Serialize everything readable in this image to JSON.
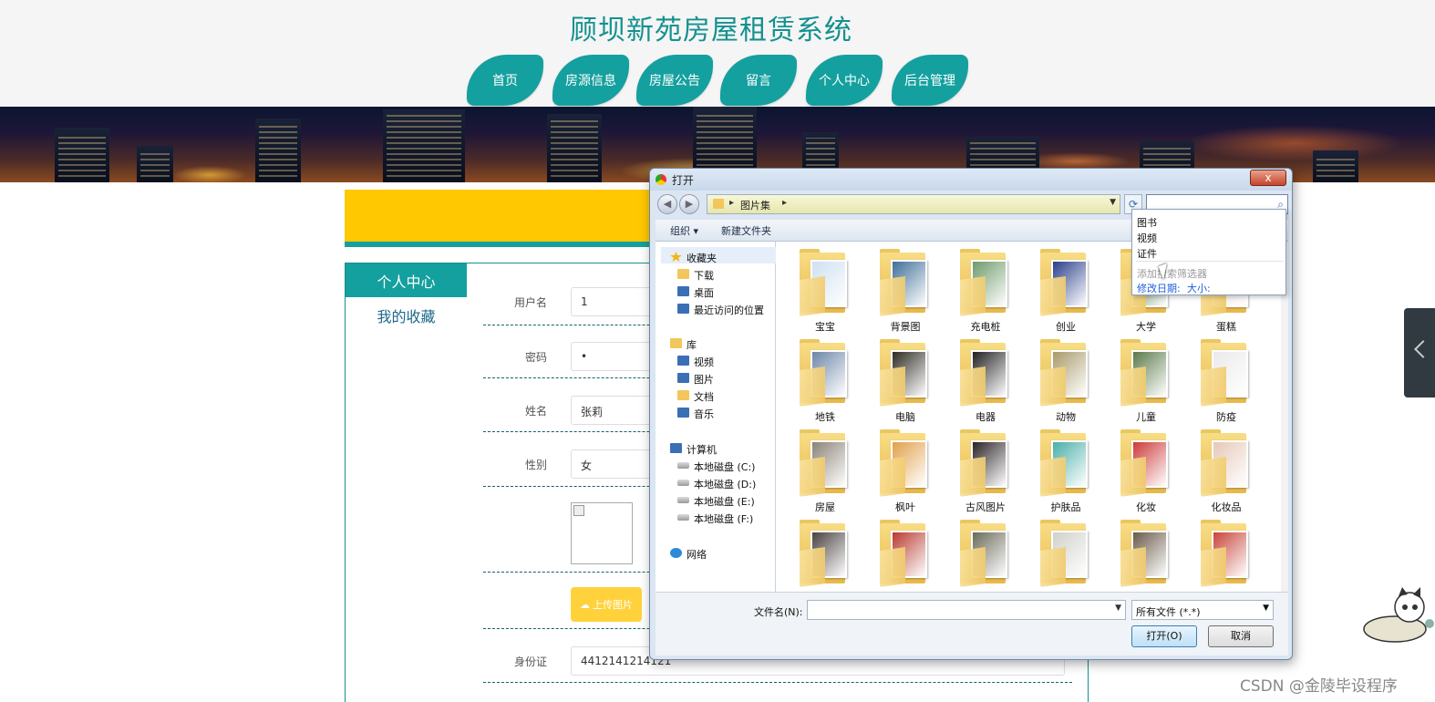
{
  "site": {
    "title": "顾坝新苑房屋租赁系统"
  },
  "nav": [
    "首页",
    "房源信息",
    "房屋公告",
    "留言",
    "个人中心",
    "后台管理"
  ],
  "sidebar": {
    "header": "个人中心",
    "link": "我的收藏"
  },
  "form": {
    "fields": [
      {
        "label": "用户名",
        "value": "1"
      },
      {
        "label": "密码",
        "value": "•"
      },
      {
        "label": "姓名",
        "value": "张莉"
      },
      {
        "label": "性别",
        "value": "女"
      },
      {
        "label": "身份证",
        "value": "4412141214121"
      }
    ],
    "upload_label": "上传图片"
  },
  "dialog": {
    "title": "打开",
    "close": "x",
    "breadcrumb": "图片集",
    "toolbar": {
      "organize": "组织 ▾",
      "new_folder": "新建文件夹"
    },
    "nav": {
      "favorites": "收藏夹",
      "downloads": "下载",
      "desktop": "桌面",
      "recent": "最近访问的位置",
      "libraries": "库",
      "videos": "视频",
      "pictures": "图片",
      "documents": "文档",
      "music": "音乐",
      "computer": "计算机",
      "drive_c": "本地磁盘 (C:)",
      "drive_d": "本地磁盘 (D:)",
      "drive_e": "本地磁盘 (E:)",
      "drive_f": "本地磁盘 (F:)",
      "network": "网络"
    },
    "folders": [
      {
        "name": "宝宝",
        "color": "#cfe0f2"
      },
      {
        "name": "背景图",
        "color": "#3f6f9a"
      },
      {
        "name": "充电桩",
        "color": "#6e9a6a"
      },
      {
        "name": "创业",
        "color": "#2a3f8a"
      },
      {
        "name": "大学",
        "color": "#3a6a3a"
      },
      {
        "name": "蛋糕",
        "color": "#e9d7d2"
      },
      {
        "name": "地铁",
        "color": "#6d86a8"
      },
      {
        "name": "电脑",
        "color": "#2d2a22"
      },
      {
        "name": "电器",
        "color": "#202020"
      },
      {
        "name": "动物",
        "color": "#a89a6a"
      },
      {
        "name": "儿童",
        "color": "#5a7a4a"
      },
      {
        "name": "防疫",
        "color": "#eaeaea"
      },
      {
        "name": "房屋",
        "color": "#8a8276"
      },
      {
        "name": "枫叶",
        "color": "#e0a04a"
      },
      {
        "name": "古风图片",
        "color": "#2a2224"
      },
      {
        "name": "护肤品",
        "color": "#4aaea8"
      },
      {
        "name": "化妆",
        "color": "#cc3a3a"
      },
      {
        "name": "化妆品",
        "color": "#e6c8b8"
      },
      {
        "name": "",
        "color": "#4a4040"
      },
      {
        "name": "",
        "color": "#b83a30"
      },
      {
        "name": "",
        "color": "#6a6a5a"
      },
      {
        "name": "",
        "color": "#d0d0cc"
      },
      {
        "name": "",
        "color": "#6a5a4a"
      },
      {
        "name": "",
        "color": "#c8443a"
      }
    ],
    "filename_label": "文件名(N):",
    "filter_value": "所有文件 (*.*)",
    "open_label": "打开(O)",
    "cancel_label": "取消",
    "search_filter": {
      "items": [
        "图书",
        "视频",
        "证件"
      ],
      "hint": "添加搜索筛选器",
      "date_link": "修改日期:",
      "size_link": "大小:"
    }
  },
  "watermark": "CSDN @金陵毕设程序"
}
